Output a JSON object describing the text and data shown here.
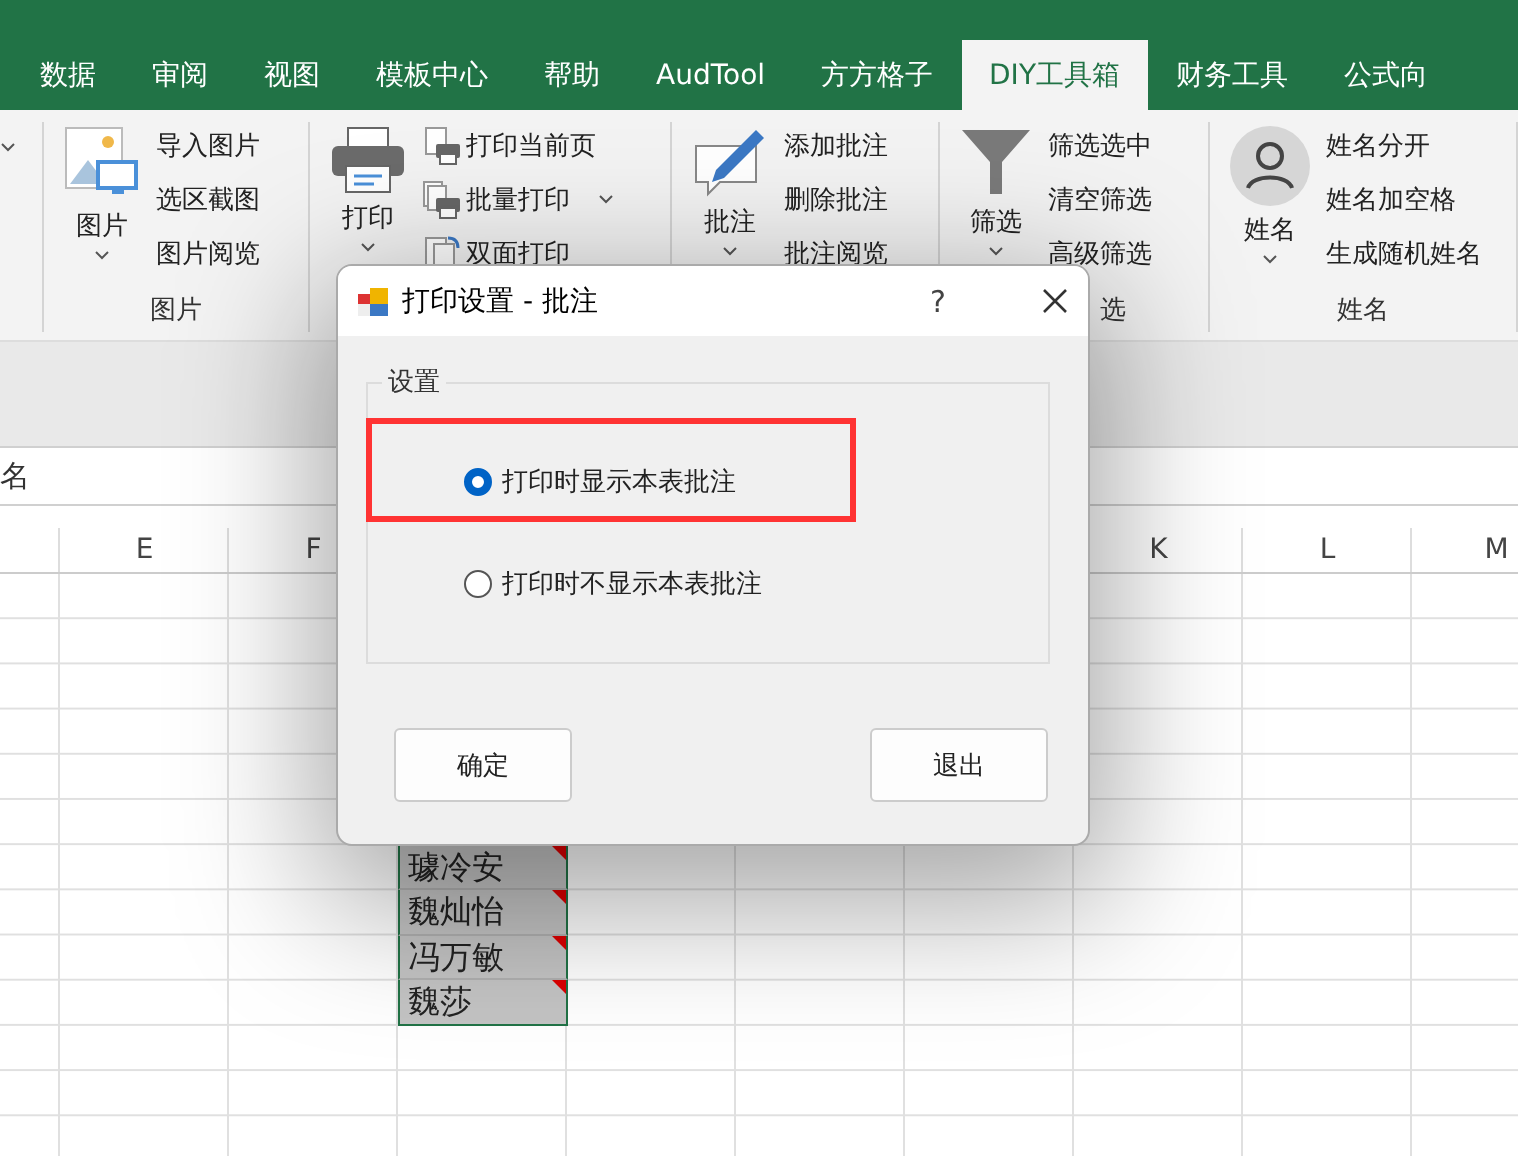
{
  "ribbon_tabs": [
    {
      "label": "数据",
      "selected": false
    },
    {
      "label": "审阅",
      "selected": false
    },
    {
      "label": "视图",
      "selected": false
    },
    {
      "label": "模板中心",
      "selected": false
    },
    {
      "label": "帮助",
      "selected": false
    },
    {
      "label": "AudTool",
      "selected": false
    },
    {
      "label": "方方格子",
      "selected": false
    },
    {
      "label": "DIY工具箱",
      "selected": true
    },
    {
      "label": "财务工具",
      "selected": false
    },
    {
      "label": "公式向",
      "selected": false
    }
  ],
  "ribbon_groups": [
    {
      "kind": "picture",
      "large_button": "图片",
      "commands": [
        {
          "label": "导入图片",
          "kind": "import"
        },
        {
          "label": "选区截图",
          "kind": "plain"
        },
        {
          "label": "图片阅览",
          "kind": "plain"
        }
      ],
      "label": "图片"
    },
    {
      "kind": "print",
      "large_button": "打印",
      "commands": [
        {
          "label": "打印当前页",
          "kind": "page-print"
        },
        {
          "label": "批量打印",
          "kind": "batch-print"
        },
        {
          "label": "双面打印",
          "kind": "duplex"
        }
      ]
    },
    {
      "kind": "comment",
      "large_button": "批注",
      "commands": [
        {
          "label": "添加批注",
          "kind": "plain"
        },
        {
          "label": "删除批注",
          "kind": "plain"
        },
        {
          "label": "批注阅览",
          "kind": "plain"
        }
      ]
    },
    {
      "kind": "filter",
      "large_button": "筛选",
      "commands": [
        {
          "label": "筛选选中",
          "kind": "plain"
        },
        {
          "label": "清空筛选",
          "kind": "plain"
        },
        {
          "label": "高级筛选",
          "kind": "plain"
        }
      ],
      "label": "选"
    },
    {
      "kind": "person",
      "large_button": "姓名",
      "commands": [
        {
          "label": "姓名分开",
          "kind": "plain"
        },
        {
          "label": "姓名加空格",
          "kind": "plain"
        },
        {
          "label": "生成随机姓名",
          "kind": "plain"
        }
      ],
      "label": "姓名"
    }
  ],
  "name_box": "名",
  "columns": [
    "",
    "E",
    "F",
    "",
    "",
    "",
    "",
    "K",
    "L",
    "M"
  ],
  "cells": [
    "璩冷安",
    "魏灿怡",
    "冯万敏",
    "魏莎"
  ],
  "dialog": {
    "title": "打印设置 - 批注",
    "help": "?",
    "group_label": "设置",
    "options": [
      {
        "label": "打印时显示本表批注",
        "selected": true
      },
      {
        "label": "打印时不显示本表批注",
        "selected": false
      }
    ],
    "buttons": [
      "确定",
      "退出"
    ]
  }
}
